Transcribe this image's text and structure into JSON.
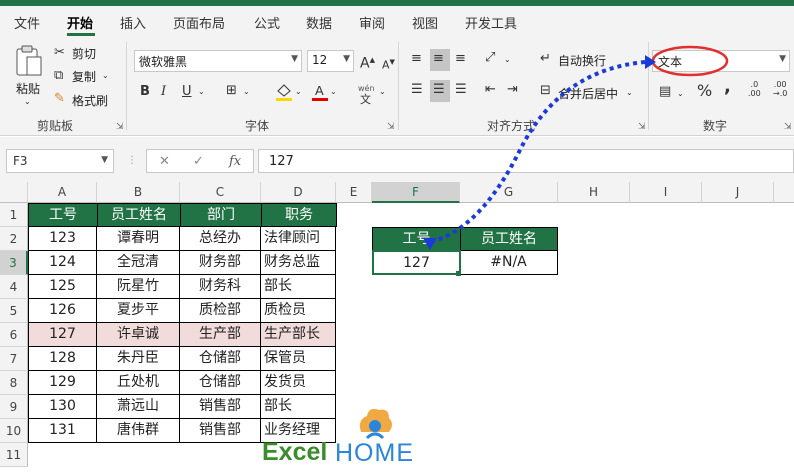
{
  "tabs": [
    "文件",
    "开始",
    "插入",
    "页面布局",
    "公式",
    "数据",
    "审阅",
    "视图",
    "开发工具"
  ],
  "clipboard": {
    "paste": "粘贴",
    "cut": "剪切",
    "copy": "复制",
    "painter": "格式刷",
    "group": "剪贴板"
  },
  "font": {
    "name": "微软雅黑",
    "size": "12",
    "group": "字体",
    "phonetic_top": "wén",
    "phonetic_bottom": "文"
  },
  "alignment": {
    "wrap": "自动换行",
    "merge": "合并后居中",
    "group": "对齐方式"
  },
  "number": {
    "format": "文本",
    "group": "数字",
    "percent": "%",
    "comma": ",",
    "inc_decimal_top": ".0",
    "inc_decimal_bottom": ".00",
    "dec_decimal_top": ".00",
    "dec_decimal_bottom": "→.0"
  },
  "formula_bar": {
    "name_box": "F3",
    "fx": "fx",
    "cancel": "✕",
    "enter": "✓",
    "value": "127"
  },
  "columns": [
    "A",
    "B",
    "C",
    "D",
    "E",
    "F",
    "G",
    "H",
    "I",
    "J"
  ],
  "rows": [
    "1",
    "2",
    "3",
    "4",
    "5",
    "6",
    "7",
    "8",
    "9",
    "10",
    "11"
  ],
  "table_headers": [
    "工号",
    "员工姓名",
    "部门",
    "职务"
  ],
  "table_rows": [
    [
      "123",
      "谭春明",
      "总经办",
      "法律顾问"
    ],
    [
      "124",
      "全冠清",
      "财务部",
      "财务总监"
    ],
    [
      "125",
      "阮星竹",
      "财务科",
      "部长"
    ],
    [
      "126",
      "夏步平",
      "质检部",
      "质检员"
    ],
    [
      "127",
      "许卓诚",
      "生产部",
      "生产部长"
    ],
    [
      "128",
      "朱丹臣",
      "仓储部",
      "保管员"
    ],
    [
      "129",
      "丘处机",
      "仓储部",
      "发货员"
    ],
    [
      "130",
      "萧远山",
      "销售部",
      "部长"
    ],
    [
      "131",
      "唐伟群",
      "销售部",
      "业务经理"
    ]
  ],
  "lookup": {
    "headers": [
      "工号",
      "员工姓名"
    ],
    "values": [
      "127",
      "#N/A"
    ]
  },
  "logo": {
    "excel": "Excel",
    "home": "HOME"
  },
  "colors": {
    "accent": "#217346",
    "highlight": "#f2dcdb",
    "arrow": "#1a3bd8",
    "callout": "#e03030"
  }
}
